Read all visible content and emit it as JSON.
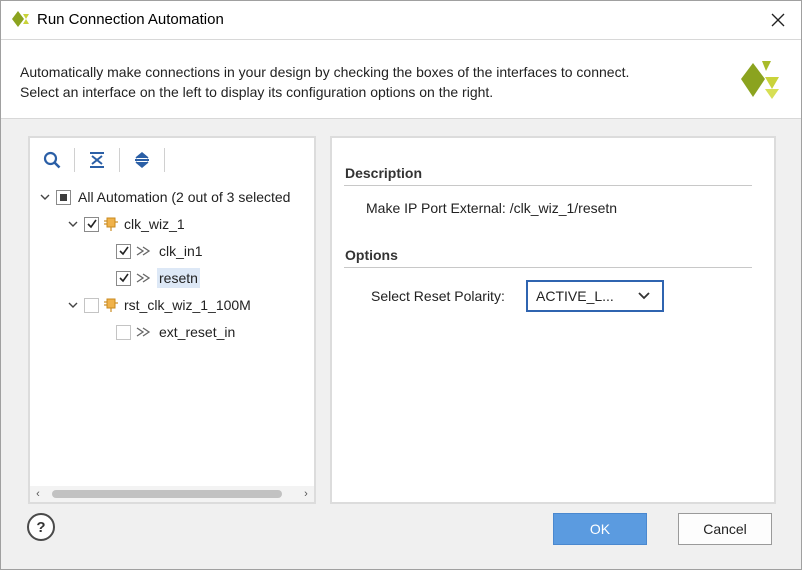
{
  "window": {
    "title": "Run Connection Automation",
    "logo_icon": "xilinx-logo-icon",
    "close_icon": "close-icon"
  },
  "header": {
    "line1": "Automatically make connections in your design by checking the boxes of the interfaces to connect.",
    "line2": "Select an interface on the left to display its configuration options on the right.",
    "logo_icon": "xilinx-logo-icon"
  },
  "toolbar": {
    "search_icon": "search-icon",
    "collapse_icon": "collapse-all-icon",
    "expand_icon": "expand-all-icon"
  },
  "tree": {
    "root": {
      "label": "All Automation (2 out of 3 selected",
      "state": "partial",
      "expanded": true
    },
    "items": [
      {
        "label": "clk_wiz_1",
        "type": "ip",
        "checked": true,
        "expanded": true,
        "children": [
          {
            "label": "clk_in1",
            "type": "port",
            "checked": true
          },
          {
            "label": "resetn",
            "type": "port",
            "checked": true,
            "selected": true
          }
        ]
      },
      {
        "label": "rst_clk_wiz_1_100M",
        "type": "ip",
        "checked": false,
        "expanded": true,
        "children": [
          {
            "label": "ext_reset_in",
            "type": "port",
            "checked": false
          }
        ]
      }
    ]
  },
  "details": {
    "description_title": "Description",
    "description_text": "Make IP Port External: /clk_wiz_1/resetn",
    "options_title": "Options",
    "reset_polarity_label": "Select Reset Polarity:",
    "reset_polarity_value": "ACTIVE_L..."
  },
  "buttons": {
    "help_label": "?",
    "ok_label": "OK",
    "cancel_label": "Cancel"
  },
  "colors": {
    "accent": "#5b9be0",
    "selection": "#dde8f6",
    "logo_green": "#8ba31f",
    "logo_yellow": "#c9d33a"
  }
}
